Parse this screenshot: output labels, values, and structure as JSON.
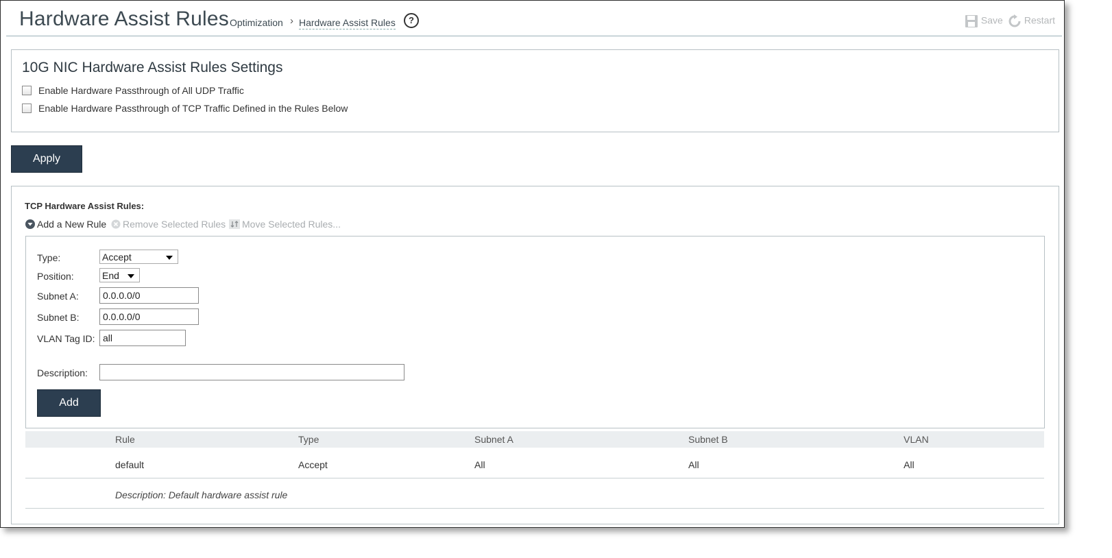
{
  "header": {
    "title": "Hardware Assist Rules",
    "breadcrumb": {
      "parent": "Optimization",
      "separator": "›",
      "current": "Hardware Assist Rules"
    },
    "help_symbol": "?",
    "save_label": "Save",
    "restart_label": "Restart",
    "icons": {
      "help": "help-circle-icon",
      "save": "floppy-disk-icon",
      "restart": "restart-icon"
    }
  },
  "settings": {
    "title": "10G NIC Hardware Assist Rules Settings",
    "checkboxes": [
      {
        "label": "Enable Hardware Passthrough of All UDP Traffic",
        "checked": false
      },
      {
        "label": "Enable Hardware Passthrough of TCP Traffic Defined in the Rules Below",
        "checked": false
      }
    ],
    "apply_label": "Apply"
  },
  "rules": {
    "title": "TCP Hardware Assist Rules:",
    "toolbar": {
      "add_label": "Add a New Rule",
      "remove_label": "Remove Selected Rules",
      "move_label": "Move Selected Rules..."
    },
    "form": {
      "type_label": "Type:",
      "type_value": "Accept",
      "position_label": "Position:",
      "position_value": "End",
      "subnet_a_label": "Subnet A:",
      "subnet_a_value": "0.0.0.0/0",
      "subnet_b_label": "Subnet B:",
      "subnet_b_value": "0.0.0.0/0",
      "vlan_label": "VLAN Tag ID:",
      "vlan_value": "all",
      "description_label": "Description:",
      "description_value": "",
      "add_label": "Add"
    },
    "table": {
      "columns": [
        "Rule",
        "Type",
        "Subnet A",
        "Subnet B",
        "VLAN"
      ],
      "rows": [
        {
          "cells": [
            "default",
            "Accept",
            "All",
            "All",
            "All"
          ],
          "description": "Description: Default hardware assist rule"
        }
      ]
    }
  },
  "colors": {
    "button_bg": "#2c3e50",
    "border": "#b7c0c4",
    "disabled_text": "#b5b8ba"
  }
}
